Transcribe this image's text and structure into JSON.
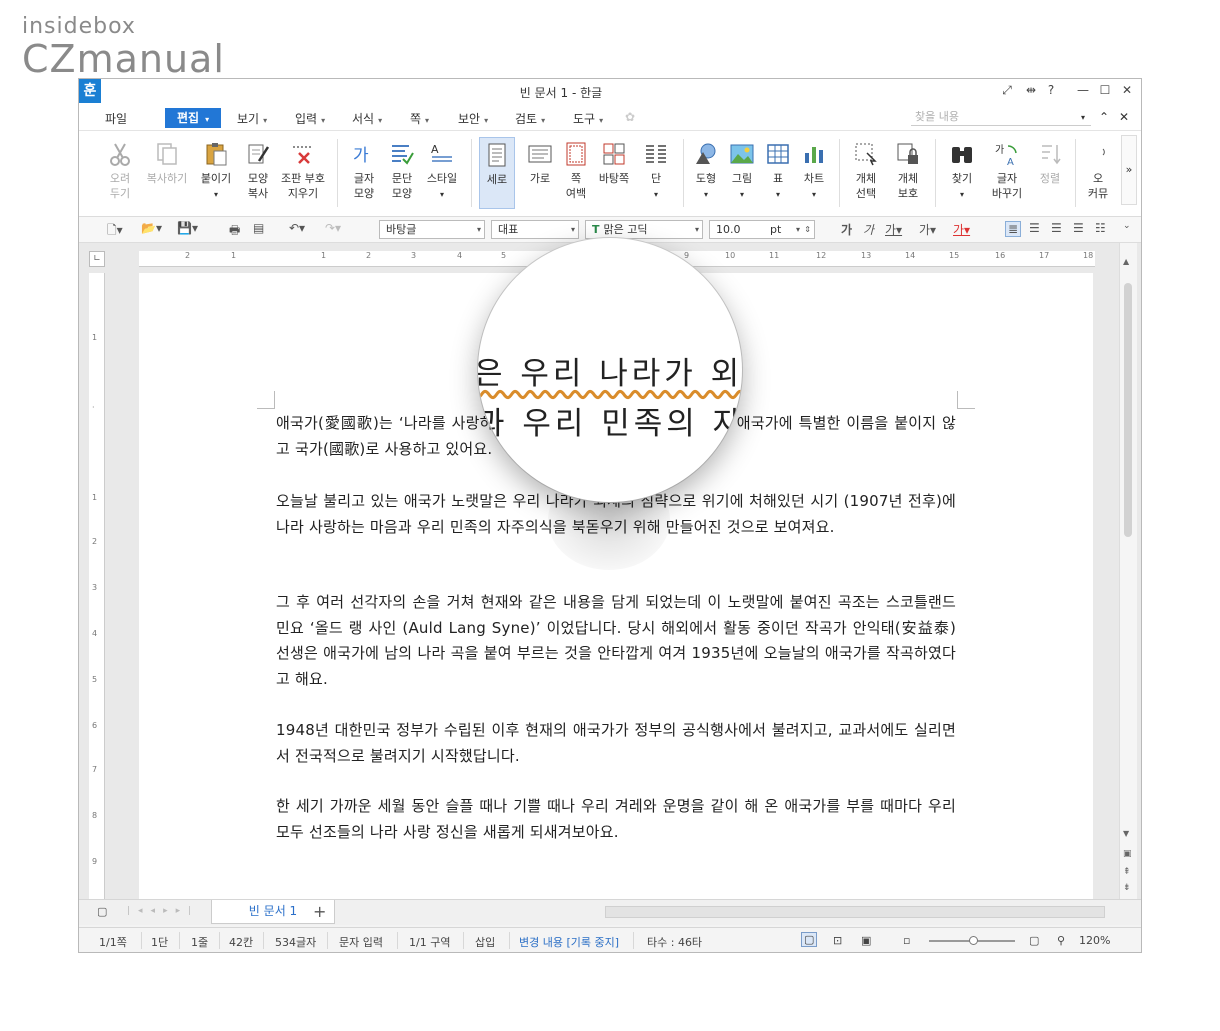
{
  "brand": {
    "line1": "insidebox",
    "line2": "CZmanual"
  },
  "window": {
    "title": "빈 문서 1 - 한글",
    "app_icon": "훈"
  },
  "menu": {
    "items": [
      "파일",
      "편집",
      "보기",
      "입력",
      "서식",
      "쪽",
      "보안",
      "검토",
      "도구"
    ],
    "active": "편집",
    "find_placeholder": "찾을 내용"
  },
  "ribbon": {
    "cut": [
      "오려",
      "두기"
    ],
    "copy": "복사하기",
    "paste": "붙이기",
    "fmtcopy": [
      "모양",
      "복사"
    ],
    "clear": [
      "조판 부호",
      "지우기"
    ],
    "charshape": [
      "글자",
      "모양"
    ],
    "parashape": [
      "문단",
      "모양"
    ],
    "style": "스타일",
    "portrait": "세로",
    "landscape": "가로",
    "margin": [
      "쪽",
      "여백"
    ],
    "background": "바탕쪽",
    "columns": "단",
    "shape": "도형",
    "picture": "그림",
    "table": "표",
    "chart": "차트",
    "objsel": [
      "개체",
      "선택"
    ],
    "objprot": [
      "개체",
      "보호"
    ],
    "find": "찾기",
    "replace": [
      "글자",
      "바꾸기"
    ],
    "sort": "정렬",
    "more": [
      "오",
      "커뮤"
    ]
  },
  "format": {
    "style": "바탕글",
    "lang": "대표",
    "font": "맑은 고딕",
    "size": "10.0",
    "unit": "pt"
  },
  "document": {
    "paragraphs": [
      "애국가(愛國歌)는 ‘나라를 사랑하는 노래’라는 뜻으로, 우리나라에서는 애국가에 특별한 이름을 붙이지 않고 국가(國歌)로 사용하고 있어요.",
      "오늘날 불리고 있는 애국가 노랫말은 우리 나라가 외세의 침략으로 위기에 처해있던 시기 (1907년 전후)에 나라 사랑하는 마음과 우리 민족의 자주의식을 북돋우기 위해 만들어진 것으로 보여져요.",
      "그 후 여러 선각자의 손을 거쳐 현재와 같은 내용을 담게 되었는데 이 노랫말에 붙여진 곡조는 스코틀랜드 민요 ‘올드 랭 사인 (Auld Lang Syne)’ 이었답니다. 당시 해외에서 활동 중이던 작곡가 안익태(安益泰) 선생은 애국가에 남의 나라 곡을 붙여 부르는 것을 안타깝게 여겨 1935년에 오늘날의 애국가를 작곡하였다고 해요.",
      "1948년 대한민국 정부가 수립된 이후 현재의 애국가가 정부의 공식행사에서 불려지고, 교과서에도 실리면서 전국적으로 불려지기 시작했답니다.",
      "한 세기 가까운 세월 동안 슬플 때나 기쁠 때나 우리 겨레와 운명을 같이 해 온 애국가를 부를 때마다 우리 모두 선조들의 나라 사랑 정신을 새롭게 되새겨보아요."
    ],
    "magnifier": {
      "line1": "은 우리 나라가 외",
      "line2": "과 우리 민족의 자"
    }
  },
  "tab": {
    "name": "빈 문서 1"
  },
  "status": {
    "page": "1/1쪽",
    "col": "1단",
    "line": "1줄",
    "pos": "42칸",
    "chars": "534글자",
    "mode": "문자 입력",
    "section": "1/1 구역",
    "insert": "삽입",
    "track": "변경 내용 [기록 중지]",
    "typing": "타수 : 46타",
    "zoom": "120%"
  }
}
